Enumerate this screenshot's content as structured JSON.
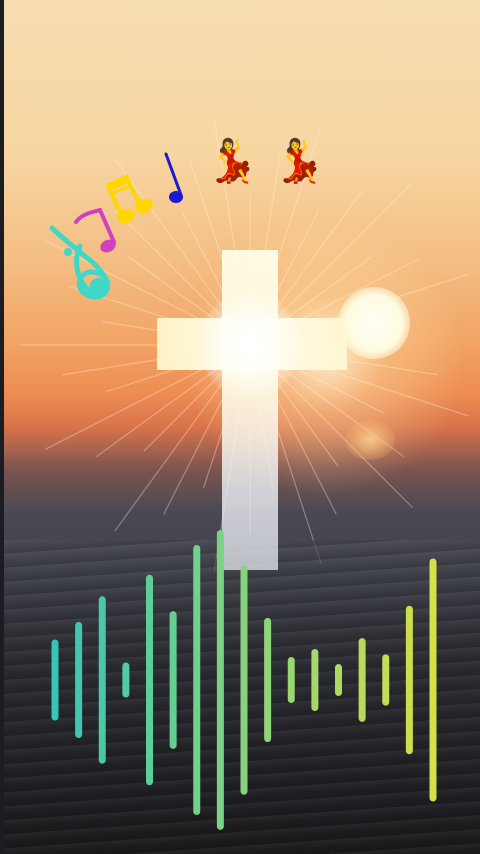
{
  "scene": {
    "description_icons": [
      "treble-clef-icon",
      "eighth-note-icon",
      "beamed-notes-icon",
      "quarter-note-icon",
      "dancer-icon",
      "dancer-icon"
    ]
  },
  "colors": {
    "note_teal": "#3fd8c8",
    "note_magenta": "#d23fc0",
    "note_yellow": "#ffd700",
    "note_blue": "#1a1ad0",
    "dancer_dress": "#d8201e"
  },
  "visualizer": {
    "bar_levels": [
      0.3,
      0.43,
      0.62,
      0.13,
      0.78,
      0.51,
      1.0,
      1.11,
      0.85,
      0.46,
      0.17,
      0.23,
      0.1,
      0.31,
      0.19,
      0.55,
      0.9
    ],
    "gradient_start": "#35c6b5",
    "gradient_end": "#d6e048"
  }
}
